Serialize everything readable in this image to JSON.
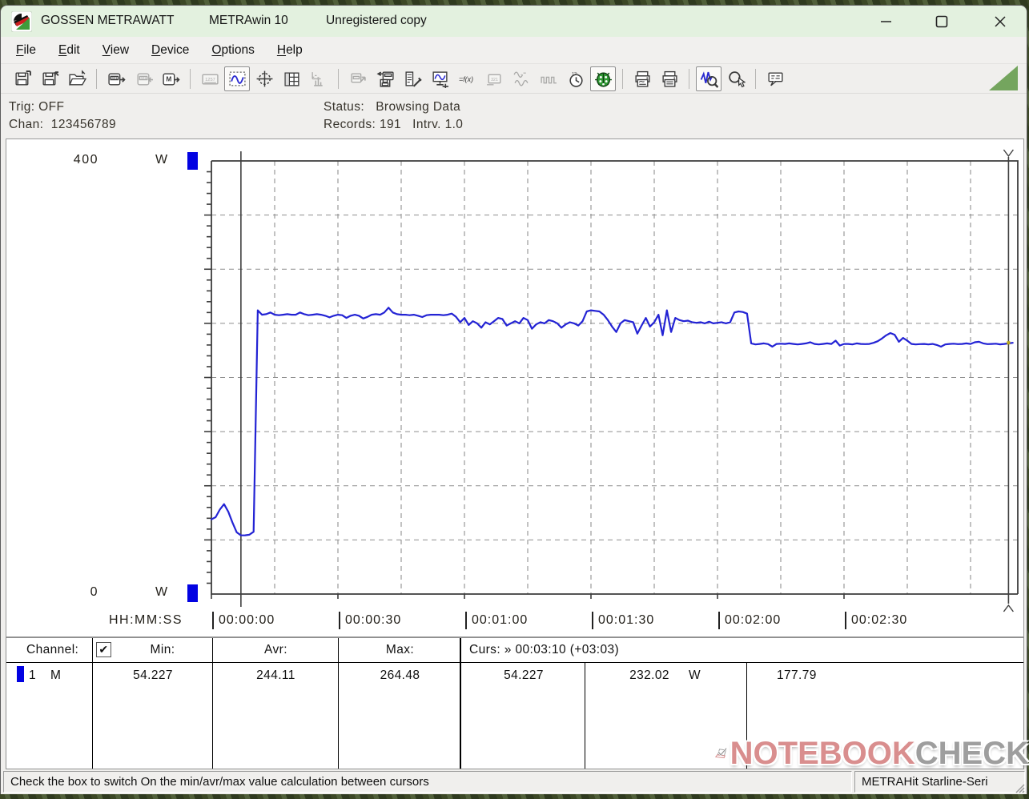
{
  "window": {
    "titles": [
      "GOSSEN METRAWATT",
      "METRAwin 10",
      "Unregistered copy"
    ],
    "controls": {
      "minimize": "minimize",
      "maximize": "maximize",
      "close": "close"
    }
  },
  "menu": {
    "items": [
      "File",
      "Edit",
      "View",
      "Device",
      "Options",
      "Help"
    ]
  },
  "toolbar": {
    "groups": [
      [
        {
          "name": "save-data",
          "state": "normal"
        },
        {
          "name": "save-as",
          "state": "normal"
        },
        {
          "name": "open-file",
          "state": "normal"
        }
      ],
      [
        {
          "name": "device-read",
          "state": "normal"
        },
        {
          "name": "device-write",
          "state": "disabled"
        },
        {
          "name": "device-memory",
          "state": "normal"
        }
      ],
      [
        {
          "name": "view-numeric",
          "state": "disabled"
        },
        {
          "name": "view-trend",
          "state": "pressed"
        },
        {
          "name": "view-xy",
          "state": "normal"
        },
        {
          "name": "view-table",
          "state": "normal"
        },
        {
          "name": "view-histogram",
          "state": "disabled"
        }
      ],
      [
        {
          "name": "export-data",
          "state": "disabled"
        },
        {
          "name": "import-device",
          "state": "normal"
        },
        {
          "name": "device-settings",
          "state": "normal"
        },
        {
          "name": "online-display",
          "state": "normal"
        },
        {
          "name": "formula",
          "state": "normal"
        },
        {
          "name": "numeric-small",
          "state": "disabled"
        },
        {
          "name": "analog-wave",
          "state": "disabled"
        },
        {
          "name": "digital-wave",
          "state": "disabled"
        },
        {
          "name": "time-settings",
          "state": "normal"
        },
        {
          "name": "record-timer",
          "state": "pressed"
        }
      ],
      [
        {
          "name": "print-preview",
          "state": "normal"
        },
        {
          "name": "print",
          "state": "normal"
        }
      ],
      [
        {
          "name": "zoom-curve",
          "state": "pressed"
        },
        {
          "name": "zoom-select",
          "state": "normal"
        }
      ],
      [
        {
          "name": "notes",
          "state": "normal"
        }
      ]
    ]
  },
  "info": {
    "trig_label": "Trig:",
    "trig_value": "OFF",
    "chan_label": "Chan:",
    "chan_value": "123456789",
    "status_label": "Status:",
    "status_value": "Browsing Data",
    "records_label": "Records:",
    "records_value": "191",
    "intrv_label": "Intrv.",
    "intrv_value": "1.0"
  },
  "chart_data": {
    "type": "line",
    "unit": "W",
    "ylim": [
      0,
      400
    ],
    "y_top_label": "400",
    "y_top_unit": "W",
    "y_bottom_label": "0",
    "y_bottom_unit": "W",
    "x_format_label": "HH:MM:SS",
    "x_tick_labels": [
      "00:00:00",
      "00:00:30",
      "00:01:00",
      "00:01:30",
      "00:02:00",
      "00:02:30"
    ],
    "x_tick_interval_s": 30,
    "grid": {
      "y_step_w": 50,
      "x_step_s": 15,
      "style": "dashed"
    },
    "records": 191,
    "interval_s": 1.0,
    "cursors": {
      "c1_t_s": 7,
      "c2_t_s": 189,
      "c1_value_w": 54.227,
      "c2_value_w": 232.02,
      "delta_w": 177.79
    },
    "stats": {
      "min_w": 54.227,
      "avr_w": 244.11,
      "max_w": 264.48
    },
    "series": [
      {
        "name": "1",
        "mode": "M",
        "color": "#2323d4",
        "t0_s": 0,
        "dt_s": 1,
        "values": [
          69,
          71,
          78,
          83,
          76,
          66,
          57,
          54.2,
          54.3,
          54.8,
          57.5,
          262,
          258,
          258.5,
          260,
          258,
          257.5,
          258,
          258.5,
          258,
          258,
          260,
          258.5,
          257.5,
          258,
          258.5,
          258,
          257,
          255.5,
          257,
          258,
          257.5,
          255,
          257,
          258,
          257,
          254.5,
          256,
          258,
          258.5,
          258,
          260,
          264.5,
          260,
          258.5,
          258,
          258,
          257.5,
          258,
          257,
          255.8,
          257.5,
          258,
          258,
          258,
          257.5,
          258,
          259,
          256,
          251,
          255,
          248.5,
          252,
          250,
          246,
          251,
          249,
          252,
          255,
          254,
          248,
          250,
          252,
          250,
          255,
          253,
          245,
          249,
          251,
          250,
          253,
          252,
          250,
          246,
          249,
          251,
          250,
          248,
          252,
          261,
          262,
          261.5,
          261,
          258,
          253,
          247,
          242,
          250,
          253,
          252,
          251,
          240.5,
          248,
          255,
          247,
          251,
          258,
          239,
          262,
          242,
          255,
          253,
          252,
          252.5,
          251,
          250.5,
          251,
          250,
          251.5,
          250,
          250.5,
          251,
          250,
          251,
          260,
          261,
          260.5,
          259,
          231.5,
          230.5,
          231,
          231.5,
          230.8,
          228.5,
          231,
          231.2,
          231,
          231.5,
          231,
          230.5,
          231,
          231.5,
          232.5,
          231,
          230.5,
          231,
          231.5,
          231,
          234,
          229.5,
          231,
          231,
          230.5,
          231.5,
          231,
          230.8,
          231,
          232,
          233.5,
          236,
          239,
          241,
          239.5,
          233,
          236.5,
          234,
          231,
          230.5,
          230.8,
          231,
          230.5,
          231,
          230,
          228.5,
          230.5,
          231,
          231.2,
          230.8,
          231,
          231.5,
          231,
          232.5,
          233,
          231.5,
          230.8,
          231,
          231.2,
          230.6,
          231,
          231.5,
          232.02
        ]
      }
    ]
  },
  "table": {
    "headers": {
      "channel": "Channel:",
      "min": "Min:",
      "avr": "Avr:",
      "max": "Max:",
      "curs": "Curs: » 00:03:10 (+03:03)"
    },
    "checkbox_checked": "✔",
    "row": {
      "num": "1",
      "mode": "M",
      "min": "54.227",
      "avr": "244.11",
      "max": "264.48",
      "c1": "54.227",
      "c2": "232.02",
      "c2_unit": "W",
      "delta": "177.79"
    }
  },
  "statusbar": {
    "message": "Check the box to switch On the min/avr/max value calculation between cursors",
    "device": "METRAHit Starline-Seri"
  },
  "watermark": {
    "part1": "NOTEBOOK",
    "part2": "CHECK"
  }
}
